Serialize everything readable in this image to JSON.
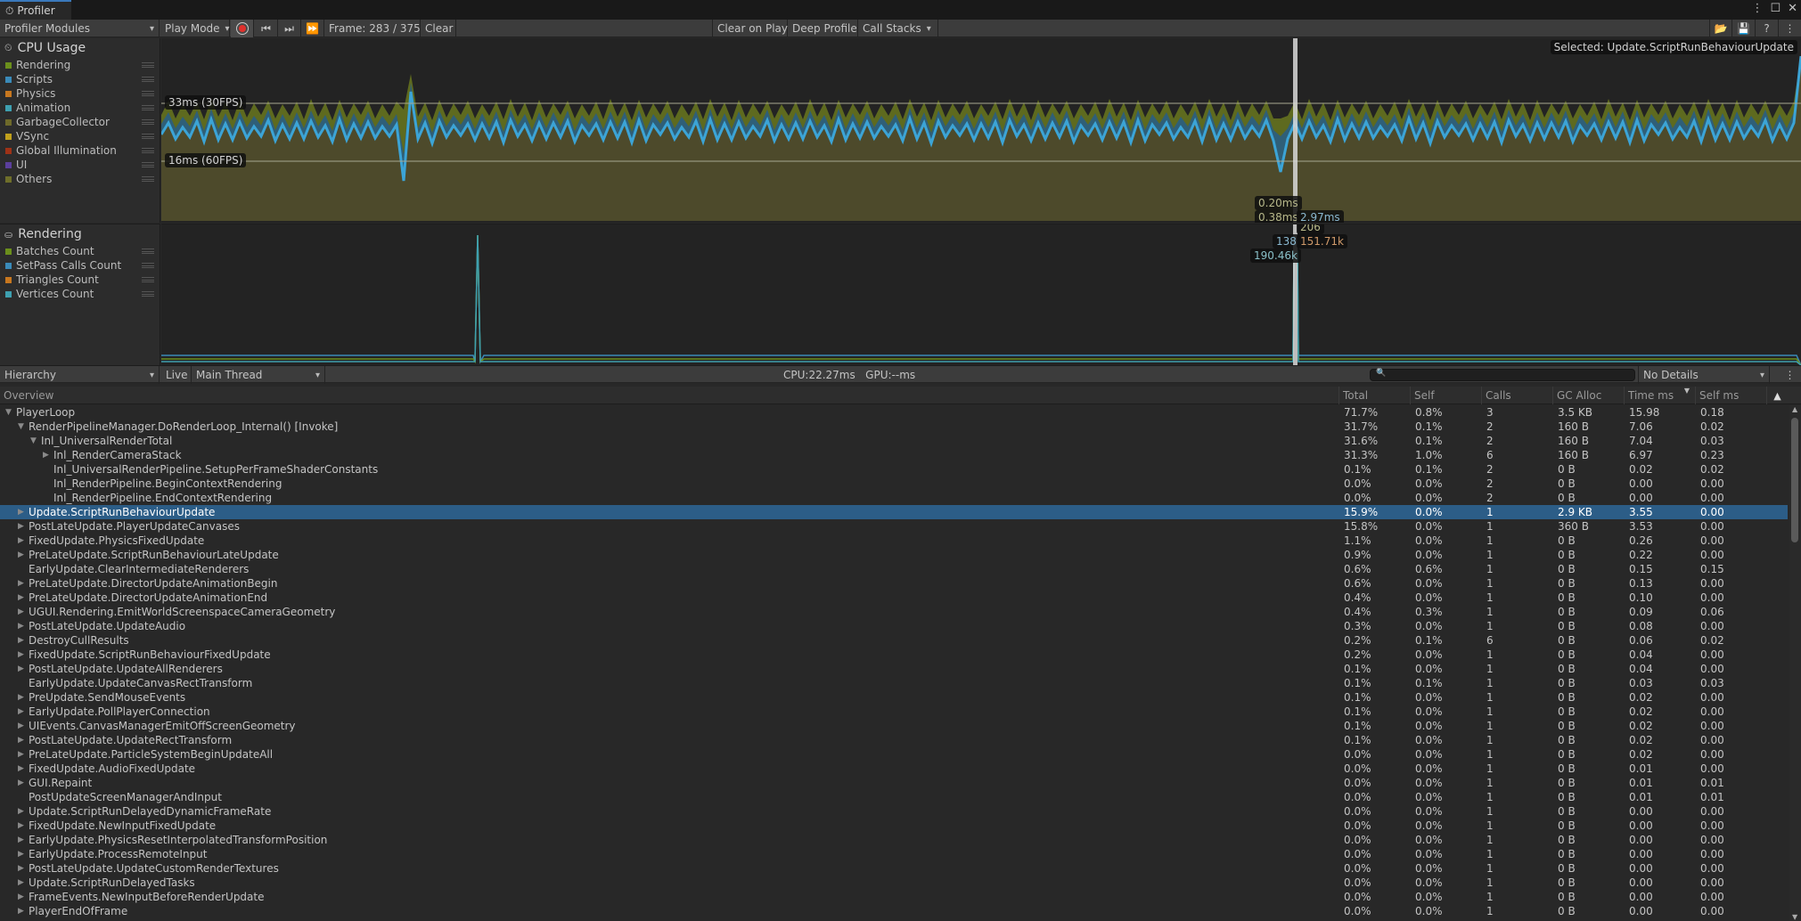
{
  "window": {
    "tab_title": "Profiler",
    "controls": [
      "more-options",
      "maximize",
      "close"
    ]
  },
  "toolbar": {
    "modules_dropdown": "Profiler Modules",
    "play_mode": "Play Mode",
    "frame_label": "Frame: 283 / 375",
    "clear": "Clear",
    "clear_on_play": "Clear on Play",
    "deep_profile": "Deep Profile",
    "call_stacks": "Call Stacks"
  },
  "cpu_module": {
    "title": "CPU Usage",
    "legend": [
      {
        "label": "Rendering",
        "color": "#6b8f1c"
      },
      {
        "label": "Scripts",
        "color": "#3a8ab8"
      },
      {
        "label": "Physics",
        "color": "#c7771f"
      },
      {
        "label": "Animation",
        "color": "#3ea0b0"
      },
      {
        "label": "GarbageCollector",
        "color": "#6e6a2a"
      },
      {
        "label": "VSync",
        "color": "#c0a01c"
      },
      {
        "label": "Global Illumination",
        "color": "#9e3217"
      },
      {
        "label": "UI",
        "color": "#5b3f9c"
      },
      {
        "label": "Others",
        "color": "#6e6e2a"
      }
    ],
    "guide_30fps": "33ms (30FPS)",
    "guide_60fps": "16ms (60FPS)",
    "selected_label": "Selected: Update.ScriptRunBehaviourUpdate",
    "readouts": [
      "0.20ms",
      "0.38ms",
      "2.97ms"
    ]
  },
  "rendering_module": {
    "title": "Rendering",
    "legend": [
      {
        "label": "Batches Count",
        "color": "#6b8f1c"
      },
      {
        "label": "SetPass Calls Count",
        "color": "#3a8ab8"
      },
      {
        "label": "Triangles Count",
        "color": "#c7771f"
      },
      {
        "label": "Vertices Count",
        "color": "#3ea0b0"
      }
    ],
    "readouts": [
      "206",
      "138",
      "151.71k",
      "190.46k"
    ]
  },
  "hierarchy_toolbar": {
    "view_dropdown": "Hierarchy",
    "live": "Live",
    "thread_dropdown": "Main Thread",
    "cpu_gpu": "CPU:22.27ms   GPU:--ms",
    "search_placeholder": "",
    "details_dropdown": "No Details"
  },
  "table": {
    "columns": [
      "Overview",
      "Total",
      "Self",
      "Calls",
      "GC Alloc",
      "Time ms",
      "Self ms"
    ],
    "sorted_column": "Time ms",
    "rows": [
      {
        "name": "PlayerLoop",
        "depth": 0,
        "expander": "open",
        "total": "71.7%",
        "self": "0.8%",
        "calls": "3",
        "gc": "3.5 KB",
        "time": "15.98",
        "selfms": "0.18"
      },
      {
        "name": "RenderPipelineManager.DoRenderLoop_Internal() [Invoke]",
        "depth": 1,
        "expander": "open",
        "total": "31.7%",
        "self": "0.1%",
        "calls": "2",
        "gc": "160 B",
        "time": "7.06",
        "selfms": "0.02"
      },
      {
        "name": "Inl_UniversalRenderTotal",
        "depth": 2,
        "expander": "open",
        "total": "31.6%",
        "self": "0.1%",
        "calls": "2",
        "gc": "160 B",
        "time": "7.04",
        "selfms": "0.03"
      },
      {
        "name": "Inl_RenderCameraStack",
        "depth": 3,
        "expander": "closed",
        "total": "31.3%",
        "self": "1.0%",
        "calls": "6",
        "gc": "160 B",
        "time": "6.97",
        "selfms": "0.23"
      },
      {
        "name": "Inl_UniversalRenderPipeline.SetupPerFrameShaderConstants",
        "depth": 3,
        "expander": "none",
        "total": "0.1%",
        "self": "0.1%",
        "calls": "2",
        "gc": "0 B",
        "time": "0.02",
        "selfms": "0.02"
      },
      {
        "name": "Inl_RenderPipeline.BeginContextRendering",
        "depth": 3,
        "expander": "none",
        "total": "0.0%",
        "self": "0.0%",
        "calls": "2",
        "gc": "0 B",
        "time": "0.00",
        "selfms": "0.00"
      },
      {
        "name": "Inl_RenderPipeline.EndContextRendering",
        "depth": 3,
        "expander": "none",
        "total": "0.0%",
        "self": "0.0%",
        "calls": "2",
        "gc": "0 B",
        "time": "0.00",
        "selfms": "0.00"
      },
      {
        "name": "Update.ScriptRunBehaviourUpdate",
        "depth": 1,
        "expander": "closed",
        "selected": true,
        "total": "15.9%",
        "self": "0.0%",
        "calls": "1",
        "gc": "2.9 KB",
        "time": "3.55",
        "selfms": "0.00"
      },
      {
        "name": "PostLateUpdate.PlayerUpdateCanvases",
        "depth": 1,
        "expander": "closed",
        "total": "15.8%",
        "self": "0.0%",
        "calls": "1",
        "gc": "360 B",
        "time": "3.53",
        "selfms": "0.00"
      },
      {
        "name": "FixedUpdate.PhysicsFixedUpdate",
        "depth": 1,
        "expander": "closed",
        "total": "1.1%",
        "self": "0.0%",
        "calls": "1",
        "gc": "0 B",
        "time": "0.26",
        "selfms": "0.00"
      },
      {
        "name": "PreLateUpdate.ScriptRunBehaviourLateUpdate",
        "depth": 1,
        "expander": "closed",
        "total": "0.9%",
        "self": "0.0%",
        "calls": "1",
        "gc": "0 B",
        "time": "0.22",
        "selfms": "0.00"
      },
      {
        "name": "EarlyUpdate.ClearIntermediateRenderers",
        "depth": 1,
        "expander": "none",
        "total": "0.6%",
        "self": "0.6%",
        "calls": "1",
        "gc": "0 B",
        "time": "0.15",
        "selfms": "0.15"
      },
      {
        "name": "PreLateUpdate.DirectorUpdateAnimationBegin",
        "depth": 1,
        "expander": "closed",
        "total": "0.6%",
        "self": "0.0%",
        "calls": "1",
        "gc": "0 B",
        "time": "0.13",
        "selfms": "0.00"
      },
      {
        "name": "PreLateUpdate.DirectorUpdateAnimationEnd",
        "depth": 1,
        "expander": "closed",
        "total": "0.4%",
        "self": "0.0%",
        "calls": "1",
        "gc": "0 B",
        "time": "0.10",
        "selfms": "0.00"
      },
      {
        "name": "UGUI.Rendering.EmitWorldScreenspaceCameraGeometry",
        "depth": 1,
        "expander": "closed",
        "total": "0.4%",
        "self": "0.3%",
        "calls": "1",
        "gc": "0 B",
        "time": "0.09",
        "selfms": "0.06"
      },
      {
        "name": "PostLateUpdate.UpdateAudio",
        "depth": 1,
        "expander": "closed",
        "total": "0.3%",
        "self": "0.0%",
        "calls": "1",
        "gc": "0 B",
        "time": "0.08",
        "selfms": "0.00"
      },
      {
        "name": "DestroyCullResults",
        "depth": 1,
        "expander": "closed",
        "total": "0.2%",
        "self": "0.1%",
        "calls": "6",
        "gc": "0 B",
        "time": "0.06",
        "selfms": "0.02"
      },
      {
        "name": "FixedUpdate.ScriptRunBehaviourFixedUpdate",
        "depth": 1,
        "expander": "closed",
        "total": "0.2%",
        "self": "0.0%",
        "calls": "1",
        "gc": "0 B",
        "time": "0.04",
        "selfms": "0.00"
      },
      {
        "name": "PostLateUpdate.UpdateAllRenderers",
        "depth": 1,
        "expander": "closed",
        "total": "0.1%",
        "self": "0.0%",
        "calls": "1",
        "gc": "0 B",
        "time": "0.04",
        "selfms": "0.00"
      },
      {
        "name": "EarlyUpdate.UpdateCanvasRectTransform",
        "depth": 1,
        "expander": "none",
        "total": "0.1%",
        "self": "0.1%",
        "calls": "1",
        "gc": "0 B",
        "time": "0.03",
        "selfms": "0.03"
      },
      {
        "name": "PreUpdate.SendMouseEvents",
        "depth": 1,
        "expander": "closed",
        "total": "0.1%",
        "self": "0.0%",
        "calls": "1",
        "gc": "0 B",
        "time": "0.02",
        "selfms": "0.00"
      },
      {
        "name": "EarlyUpdate.PollPlayerConnection",
        "depth": 1,
        "expander": "closed",
        "total": "0.1%",
        "self": "0.0%",
        "calls": "1",
        "gc": "0 B",
        "time": "0.02",
        "selfms": "0.00"
      },
      {
        "name": "UIEvents.CanvasManagerEmitOffScreenGeometry",
        "depth": 1,
        "expander": "closed",
        "total": "0.1%",
        "self": "0.0%",
        "calls": "1",
        "gc": "0 B",
        "time": "0.02",
        "selfms": "0.00"
      },
      {
        "name": "PostLateUpdate.UpdateRectTransform",
        "depth": 1,
        "expander": "closed",
        "total": "0.1%",
        "self": "0.0%",
        "calls": "1",
        "gc": "0 B",
        "time": "0.02",
        "selfms": "0.00"
      },
      {
        "name": "PreLateUpdate.ParticleSystemBeginUpdateAll",
        "depth": 1,
        "expander": "closed",
        "total": "0.0%",
        "self": "0.0%",
        "calls": "1",
        "gc": "0 B",
        "time": "0.02",
        "selfms": "0.00"
      },
      {
        "name": "FixedUpdate.AudioFixedUpdate",
        "depth": 1,
        "expander": "closed",
        "total": "0.0%",
        "self": "0.0%",
        "calls": "1",
        "gc": "0 B",
        "time": "0.01",
        "selfms": "0.00"
      },
      {
        "name": "GUI.Repaint",
        "depth": 1,
        "expander": "closed",
        "total": "0.0%",
        "self": "0.0%",
        "calls": "1",
        "gc": "0 B",
        "time": "0.01",
        "selfms": "0.01"
      },
      {
        "name": "PostUpdateScreenManagerAndInput",
        "depth": 1,
        "expander": "none",
        "total": "0.0%",
        "self": "0.0%",
        "calls": "1",
        "gc": "0 B",
        "time": "0.01",
        "selfms": "0.01"
      },
      {
        "name": "Update.ScriptRunDelayedDynamicFrameRate",
        "depth": 1,
        "expander": "closed",
        "total": "0.0%",
        "self": "0.0%",
        "calls": "1",
        "gc": "0 B",
        "time": "0.00",
        "selfms": "0.00"
      },
      {
        "name": "FixedUpdate.NewInputFixedUpdate",
        "depth": 1,
        "expander": "closed",
        "total": "0.0%",
        "self": "0.0%",
        "calls": "1",
        "gc": "0 B",
        "time": "0.00",
        "selfms": "0.00"
      },
      {
        "name": "EarlyUpdate.PhysicsResetInterpolatedTransformPosition",
        "depth": 1,
        "expander": "closed",
        "total": "0.0%",
        "self": "0.0%",
        "calls": "1",
        "gc": "0 B",
        "time": "0.00",
        "selfms": "0.00"
      },
      {
        "name": "EarlyUpdate.ProcessRemoteInput",
        "depth": 1,
        "expander": "closed",
        "total": "0.0%",
        "self": "0.0%",
        "calls": "1",
        "gc": "0 B",
        "time": "0.00",
        "selfms": "0.00"
      },
      {
        "name": "PostLateUpdate.UpdateCustomRenderTextures",
        "depth": 1,
        "expander": "closed",
        "total": "0.0%",
        "self": "0.0%",
        "calls": "1",
        "gc": "0 B",
        "time": "0.00",
        "selfms": "0.00"
      },
      {
        "name": "Update.ScriptRunDelayedTasks",
        "depth": 1,
        "expander": "closed",
        "total": "0.0%",
        "self": "0.0%",
        "calls": "1",
        "gc": "0 B",
        "time": "0.00",
        "selfms": "0.00"
      },
      {
        "name": "FrameEvents.NewInputBeforeRenderUpdate",
        "depth": 1,
        "expander": "closed",
        "total": "0.0%",
        "self": "0.0%",
        "calls": "1",
        "gc": "0 B",
        "time": "0.00",
        "selfms": "0.00"
      },
      {
        "name": "PlayerEndOfFrame",
        "depth": 1,
        "expander": "closed",
        "total": "0.0%",
        "self": "0.0%",
        "calls": "1",
        "gc": "0 B",
        "time": "0.00",
        "selfms": "0.00"
      }
    ]
  },
  "colors": {
    "selection": "#2c5d87",
    "rendering_fill": "#4d4a2b",
    "rendering_top": "#5e6a1f",
    "scripts_band": "#2f5f78",
    "scripts_line": "#3ca4d6",
    "record": "#e0312d"
  }
}
